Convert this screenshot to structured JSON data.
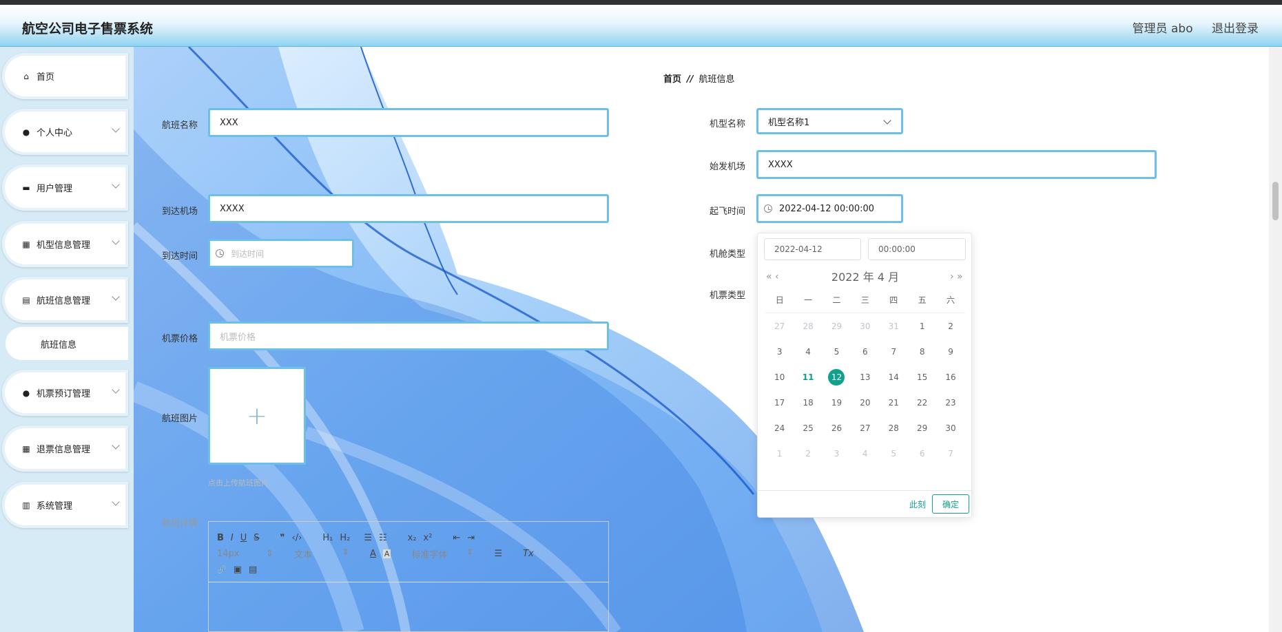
{
  "header": {
    "title": "航空公司电子售票系统",
    "user": "管理员 abo",
    "logout": "退出登录"
  },
  "sidebar": {
    "items": [
      {
        "label": "首页",
        "icon": "home-icon"
      },
      {
        "label": "个人中心",
        "icon": "user-icon"
      },
      {
        "label": "用户管理",
        "icon": "briefcase-icon"
      },
      {
        "label": "机型信息管理",
        "icon": "grid-icon"
      },
      {
        "label": "航班信息管理",
        "icon": "clipboard-icon"
      },
      {
        "label": "机票预订管理",
        "icon": "user-icon"
      },
      {
        "label": "退票信息管理",
        "icon": "grid-icon"
      },
      {
        "label": "系统管理",
        "icon": "chart-icon"
      }
    ],
    "sub_item": "航班信息"
  },
  "breadcrumb": {
    "home": "首页",
    "sep": "//",
    "current": "航班信息"
  },
  "form": {
    "flight_name": {
      "label": "航班名称",
      "value": "XXX"
    },
    "arrive_airport": {
      "label": "到达机场",
      "value": "XXXX"
    },
    "arrive_time": {
      "label": "到达时间",
      "placeholder": "到达时间"
    },
    "price": {
      "label": "机票价格",
      "placeholder": "机票价格"
    },
    "image": {
      "label": "航班图片",
      "hint": "点击上传航班图片",
      "plus": "+"
    },
    "details": {
      "label": "航班详情"
    },
    "model": {
      "label": "机型名称",
      "value": "机型名称1"
    },
    "depart_airport": {
      "label": "始发机场",
      "value": "XXXX"
    },
    "depart_time": {
      "label": "起飞时间",
      "value": "2022-04-12 00:00:00"
    },
    "cabin": {
      "label": "机舱类型"
    },
    "ticket_type": {
      "label": "机票类型"
    }
  },
  "editor": {
    "row1": [
      "B",
      "I",
      "U",
      "S",
      "❞",
      "‹/›",
      "H₁",
      "H₂",
      "☰",
      "☷",
      "x₂",
      "x²",
      "⇤",
      "⇥"
    ],
    "size": "14px",
    "text": "文本",
    "font": "标准字体",
    "row2_icons": [
      "A",
      "A",
      "☰",
      "Tx"
    ],
    "row3": [
      "🔗",
      "▣",
      "▤"
    ]
  },
  "datepicker": {
    "date_input": "2022-04-12",
    "time_input": "00:00:00",
    "header": "2022 年  4 月",
    "prev": "« ‹",
    "next": "› »",
    "weekdays": [
      "日",
      "一",
      "二",
      "三",
      "四",
      "五",
      "六"
    ],
    "weeks": [
      [
        "27",
        "28",
        "29",
        "30",
        "31",
        "1",
        "2"
      ],
      [
        "3",
        "4",
        "5",
        "6",
        "7",
        "8",
        "9"
      ],
      [
        "10",
        "11",
        "12",
        "13",
        "14",
        "15",
        "16"
      ],
      [
        "17",
        "18",
        "19",
        "20",
        "21",
        "22",
        "23"
      ],
      [
        "24",
        "25",
        "26",
        "27",
        "28",
        "29",
        "30"
      ],
      [
        "1",
        "2",
        "3",
        "4",
        "5",
        "6",
        "7"
      ]
    ],
    "today": "11",
    "selected": "12",
    "now_label": "此刻",
    "ok_label": "确定"
  },
  "colors": {
    "accent": "#11a08b",
    "border": "#6cc0e8",
    "sidebar": "#d7ebf7"
  }
}
